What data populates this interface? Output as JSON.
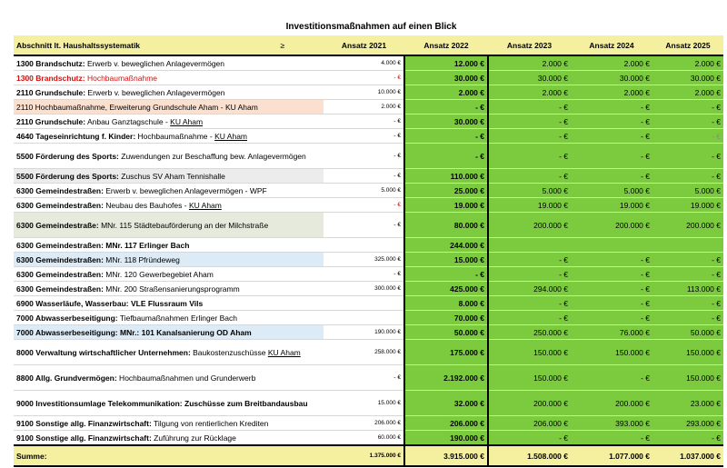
{
  "title": "Investitionsmaßnahmen auf einen Blick",
  "headers": {
    "section": "Abschnitt lt. Haushaltssystematik",
    "sort_marker": "≥",
    "a2021": "Ansatz 2021",
    "a2022": "Ansatz 2022",
    "a2023": "Ansatz 2023",
    "a2024": "Ansatz 2024",
    "a2025": "Ansatz 2025"
  },
  "rows": [
    {
      "bold": "1300 Brandschutz:",
      "text": " Erwerb v. beweglichen Anlagevermögen",
      "u": "",
      "a2021": "4.000 €",
      "a2022": "12.000 €",
      "a2023": "2.000 €",
      "a2024": "2.000 €",
      "a2025": "2.000 €"
    },
    {
      "bold": "1300 Brandschutz:",
      "text": " Hochbaumaßnahme",
      "u": "",
      "a2021": "-   €",
      "a2022": "30.000 €",
      "a2023": "30.000 €",
      "a2024": "30.000 €",
      "a2025": "30.000 €"
    },
    {
      "bold": "2110 Grundschule:",
      "text": " Erwerb v. beweglichen Anlagevermögen",
      "u": "",
      "a2021": "10.000 €",
      "a2022": "2.000 €",
      "a2023": "2.000 €",
      "a2024": "2.000 €",
      "a2025": "2.000 €"
    },
    {
      "bold": "",
      "text": "2110 Hochbaumaßnahme, Erweiterung Grundschule Aham - KU Aham",
      "u": "",
      "a2021": "2.000 €",
      "a2022": "-   €",
      "a2023": "-   €",
      "a2024": "-   €",
      "a2025": "-   €"
    },
    {
      "bold": "2110 Grundschule:",
      "text": " Anbau Ganztagschule - ",
      "u": "KU Aham",
      "a2021": "-   €",
      "a2022": "30.000 €",
      "a2023": "-   €",
      "a2024": "-   €",
      "a2025": "-   €"
    },
    {
      "bold": "4640 Tageseinrichtung f. Kinder:",
      "text": " Hochbaumaßnahme - ",
      "u": "KU Aham",
      "a2021": "-   €",
      "a2022": "-   €",
      "a2023": "-   €",
      "a2024": "-   €",
      "a2025": "-   €"
    },
    {
      "bold": "5500 Förderung des Sports:",
      "text": " Zuwendungen zur Beschaffung bew. Anlagevermögen",
      "u": "",
      "a2021": "-   €",
      "a2022": "-   €",
      "a2023": "-   €",
      "a2024": "-   €",
      "a2025": "-   €"
    },
    {
      "bold": "5500 Förderung des Sports:",
      "text": " Zuschus SV Aham Tennishalle",
      "u": "",
      "a2021": "-   €",
      "a2022": "110.000 €",
      "a2023": "-   €",
      "a2024": "-   €",
      "a2025": "-   €"
    },
    {
      "bold": "6300 Gemeindestraßen:",
      "text": " Erwerb v. beweglichen Anlagevermögen - WPF",
      "u": "",
      "a2021": "5.000 €",
      "a2022": "25.000 €",
      "a2023": "5.000 €",
      "a2024": "5.000 €",
      "a2025": "5.000 €"
    },
    {
      "bold": "6300 Gemeindestraßen:",
      "text": " Neubau des Bauhofes - ",
      "u": "KU Aham",
      "a2021": "-   €",
      "a2022": "19.000 €",
      "a2023": "19.000 €",
      "a2024": "19.000 €",
      "a2025": "19.000 €"
    },
    {
      "bold": "6300 Gemeindestraße:",
      "text": " MNr. 115 Städtebauförderung an der Milchstraße",
      "u": "",
      "a2021": "-   €",
      "a2022": "80.000 €",
      "a2023": "200.000 €",
      "a2024": "200.000 €",
      "a2025": "200.000 €"
    },
    {
      "bold": "6300 Gemeindestraßen: MNr. 117 Erlinger Bach",
      "text": "",
      "u": "",
      "a2021": "",
      "a2022": "244.000 €",
      "a2023": "",
      "a2024": "",
      "a2025": ""
    },
    {
      "bold": "6300 Gemeindestraßen:",
      "text": " MNr.  118 Pfründeweg",
      "u": "",
      "a2021": "325.000 €",
      "a2022": "15.000 €",
      "a2023": "-   €",
      "a2024": "-   €",
      "a2025": "-   €"
    },
    {
      "bold": "6300 Gemeindestraßen:",
      "text": " MNr. 120 Gewerbegebiet Aham",
      "u": "",
      "a2021": "-   €",
      "a2022": "-   €",
      "a2023": "-   €",
      "a2024": "-   €",
      "a2025": "-   €"
    },
    {
      "bold": "6300 Gemeindestraßen:",
      "text": " MNr. 200 Straßensanierungsprogramm",
      "u": "",
      "a2021": "300.000 €",
      "a2022": "425.000 €",
      "a2023": "294.000 €",
      "a2024": "-   €",
      "a2025": "113.000 €"
    },
    {
      "bold": "6900 Wasserläufe, Wasserbau: VLE Flussraum Vils",
      "text": "",
      "u": "",
      "a2021": "",
      "a2022": "8.000 €",
      "a2023": "-   €",
      "a2024": "-   €",
      "a2025": "-   €"
    },
    {
      "bold": "7000 Abwasserbeseitigung:",
      "text": " Tiefbaumaßnahmen Erlinger Bach",
      "u": "",
      "a2021": "",
      "a2022": "70.000 €",
      "a2023": "-   €",
      "a2024": "-   €",
      "a2025": "-   €"
    },
    {
      "bold": "7000 Abwasserbeseitigung:",
      "text": " MNr.: 101 Kanalsanierung OD Aham",
      "u": "",
      "a2021": "190.000 €",
      "a2022": "50.000 €",
      "a2023": "250.000 €",
      "a2024": "76.000 €",
      "a2025": "50.000 €"
    },
    {
      "bold": "8000 Verwaltung wirtschaftlicher Unternehmen:",
      "text": " Baukostenzuschüsse ",
      "u": "KU Aham",
      "a2021": "258.000 €",
      "a2022": "175.000 €",
      "a2023": "150.000 €",
      "a2024": "150.000 €",
      "a2025": "150.000 €"
    },
    {
      "bold": "8800 Allg. Grundvermögen:",
      "text": " Hochbaumaßnahmen und Grunderwerb",
      "u": "",
      "a2021": "-   €",
      "a2022": "2.192.000 €",
      "a2023": "150.000 €",
      "a2024": "-   €",
      "a2025": "150.000 €"
    },
    {
      "bold": "9000 Investitionsumlage Telekommunikation: Zuschüsse zum Breitbandausbau",
      "text": "",
      "u": "",
      "a2021": "15.000 €",
      "a2022": "32.000 €",
      "a2023": "200.000 €",
      "a2024": "200.000 €",
      "a2025": "23.000 €"
    },
    {
      "bold": "9100 Sonstige allg. Finanzwirtschaft:",
      "text": " Tilgung von rentierlichen Krediten",
      "u": "",
      "a2021": "206.000 €",
      "a2022": "206.000 €",
      "a2023": "206.000 €",
      "a2024": "393.000 €",
      "a2025": "293.000 €"
    },
    {
      "bold": "9100 Sonstige allg. Finanzwirtschaft:",
      "text": " Zuführung zur Rücklage",
      "u": "",
      "a2021": "60.000 €",
      "a2022": "190.000 €",
      "a2023": "-   €",
      "a2024": "-   €",
      "a2025": "-   €"
    }
  ],
  "sum": {
    "label": "Summe:",
    "a2021": "1.375.000 €",
    "a2022": "3.915.000 €",
    "a2023": "1.508.000 €",
    "a2024": "1.077.000 €",
    "a2025": "1.037.000 €"
  }
}
